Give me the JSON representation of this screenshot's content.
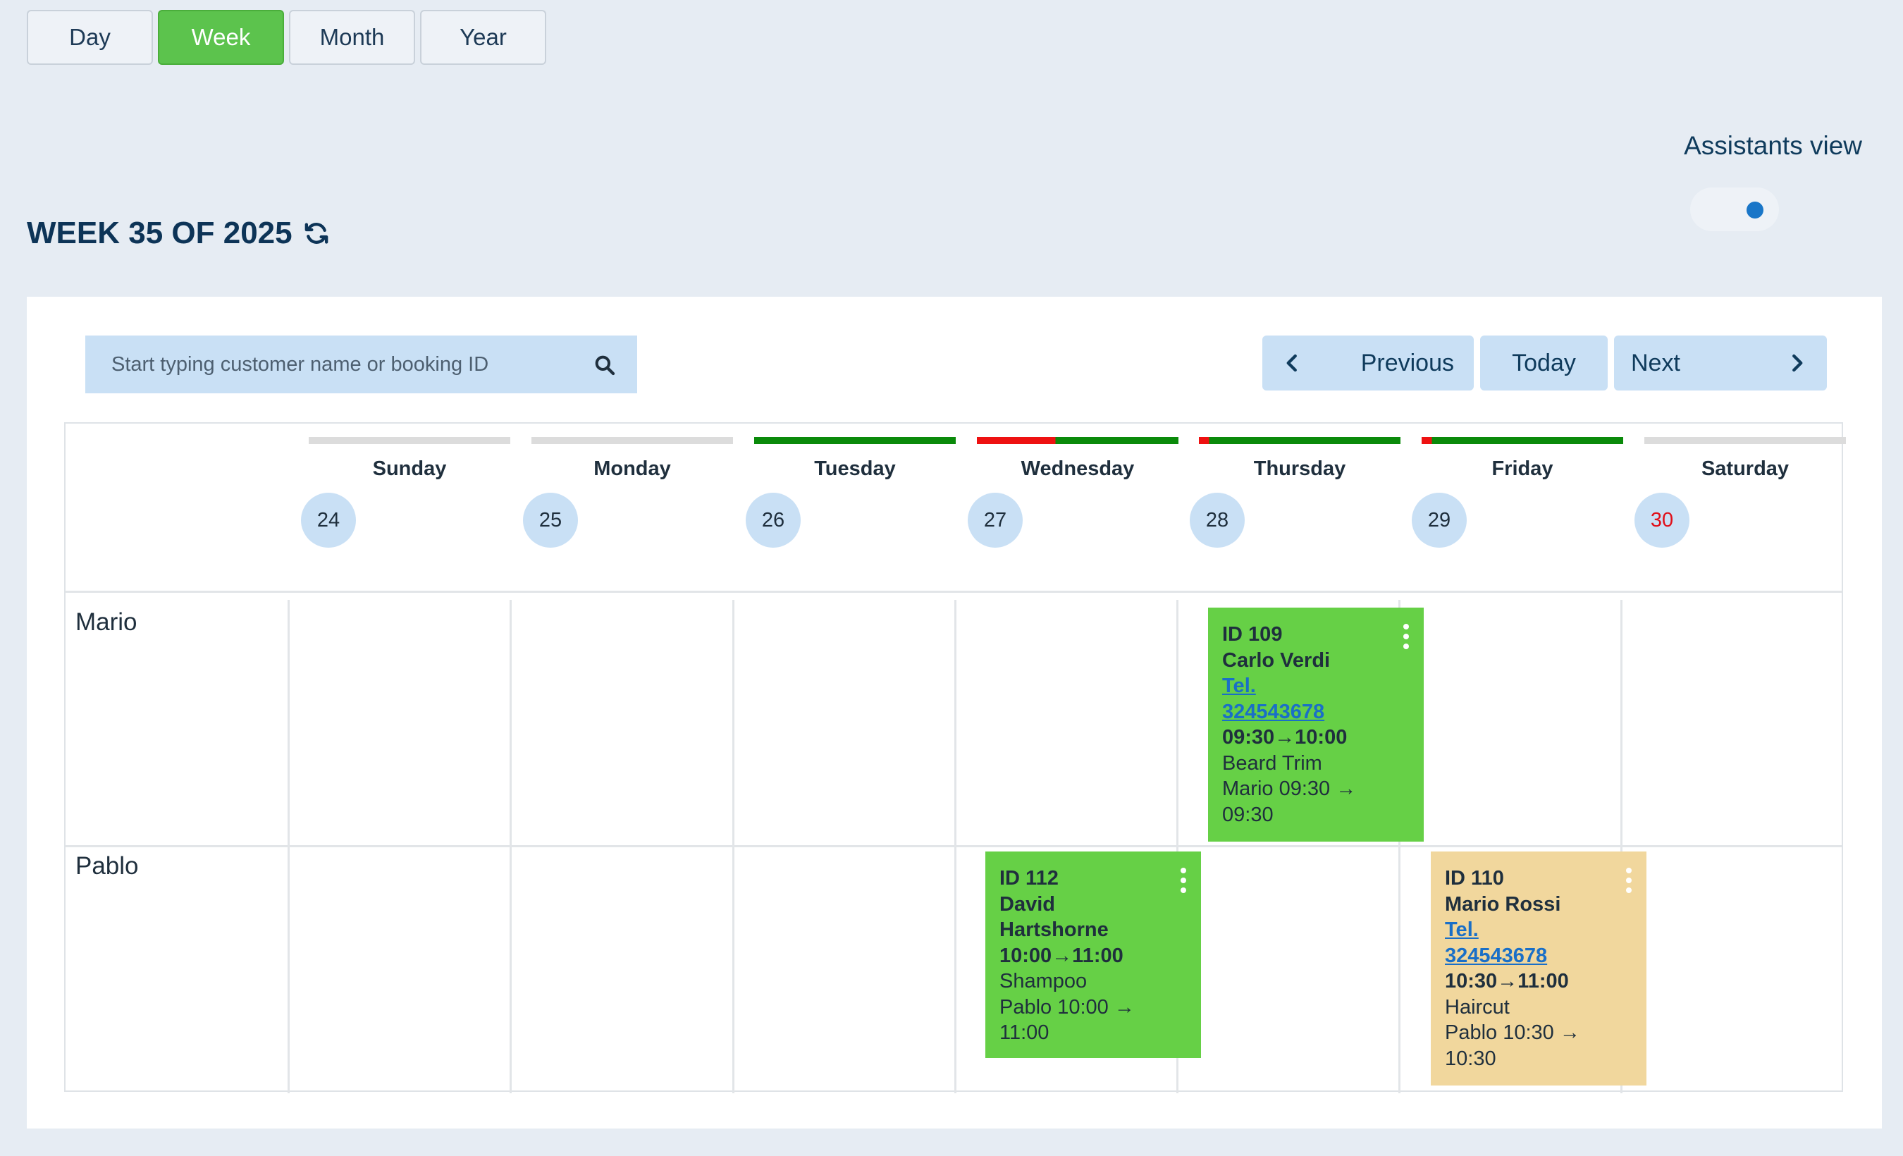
{
  "views": [
    {
      "label": "Day",
      "active": false
    },
    {
      "label": "Week",
      "active": true
    },
    {
      "label": "Month",
      "active": false
    },
    {
      "label": "Year",
      "active": false
    }
  ],
  "assistants_view": {
    "label": "Assistants view",
    "enabled": true
  },
  "week_title": "WEEK 35 OF 2025",
  "search": {
    "placeholder": "Start typing customer name or booking ID"
  },
  "nav": {
    "previous": "Previous",
    "today": "Today",
    "next": "Next"
  },
  "days": [
    {
      "name": "Sunday",
      "num": "24"
    },
    {
      "name": "Monday",
      "num": "25"
    },
    {
      "name": "Tuesday",
      "num": "26"
    },
    {
      "name": "Wednesday",
      "num": "27"
    },
    {
      "name": "Thursday",
      "num": "28"
    },
    {
      "name": "Friday",
      "num": "29"
    },
    {
      "name": "Saturday",
      "num": "30"
    }
  ],
  "rows": [
    {
      "name": "Mario"
    },
    {
      "name": "Pablo"
    }
  ],
  "bookings": [
    {
      "id": "ID 109",
      "customer": "Carlo Verdi",
      "tel_label": "Tel.",
      "tel": "324543678",
      "time": "09:30→10:00",
      "service": "Beard Trim",
      "assistant_line1": "Mario 09:30 →",
      "assistant_line2": "09:30"
    },
    {
      "id": "ID 112",
      "customer_line1": "David",
      "customer_line2": "Hartshorne",
      "time": "10:00→11:00",
      "service": "Shampoo",
      "assistant_line1": "Pablo 10:00 →",
      "assistant_line2": "11:00"
    },
    {
      "id": "ID 110",
      "customer": "Mario Rossi",
      "tel_label": "Tel.",
      "tel": "324543678",
      "time": "10:30→11:00",
      "service": "Haircut",
      "assistant_line1": "Pablo 10:30 →",
      "assistant_line2": "10:30"
    }
  ],
  "colors": {
    "accent": "#5cc34d",
    "light_blue": "#c9e0f5",
    "booking_green": "#66d046",
    "booking_tan": "#f1d79d",
    "weekend": "#e0101a",
    "available": "#0a8a0a",
    "busy": "#ee1111",
    "empty": "#dcdcdc"
  }
}
